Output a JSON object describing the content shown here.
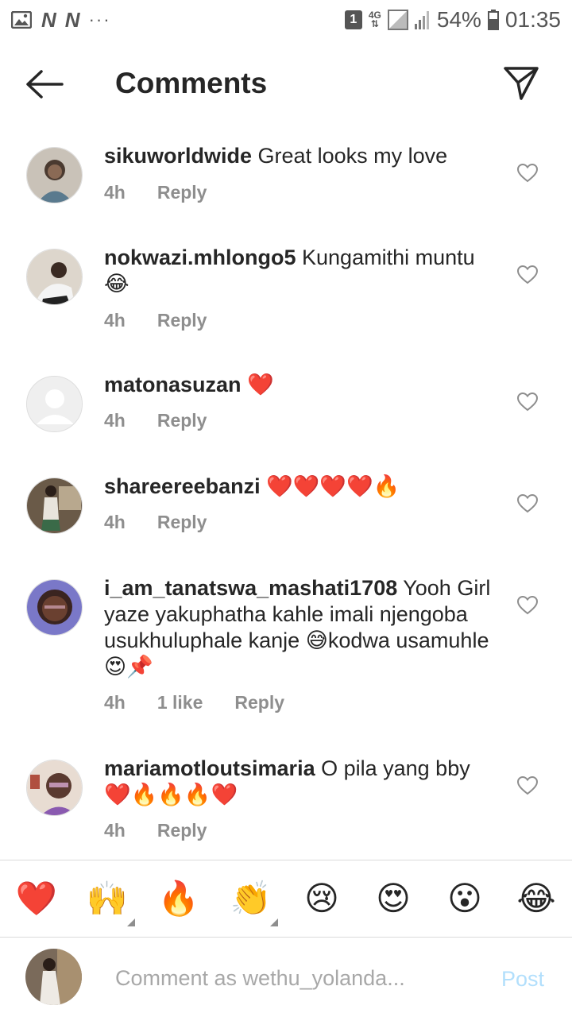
{
  "status_bar": {
    "sim_slot": "1",
    "network": "4G",
    "battery": "54%",
    "time": "01:35",
    "dots": "···"
  },
  "header": {
    "title": "Comments",
    "back_icon": "arrow-left-icon",
    "send_icon": "paper-plane-icon"
  },
  "comments": [
    {
      "username": "sikuworldwide",
      "text": " Great looks my love",
      "time": "4h",
      "likes": "",
      "reply": "Reply"
    },
    {
      "username": "nokwazi.mhlongo5",
      "text": " Kungamithi muntu 😂",
      "time": "4h",
      "likes": "",
      "reply": "Reply"
    },
    {
      "username": "matonasuzan",
      "text": " ❤️",
      "time": "4h",
      "likes": "",
      "reply": "Reply"
    },
    {
      "username": "shareereebanzi",
      "text": " ❤️❤️❤️❤️🔥",
      "time": "4h",
      "likes": "",
      "reply": "Reply"
    },
    {
      "username": "i_am_tanatswa_mashati1708",
      "text": " Yooh Girl yaze yakuphatha kahle imali njengoba usukhuluphale kanje 😅kodwa usamuhle 😍📌",
      "time": "4h",
      "likes": "1 like",
      "reply": "Reply"
    },
    {
      "username": "mariamotloutsimaria",
      "text": " O pila yang bby ❤️🔥🔥🔥❤️",
      "time": "4h",
      "likes": "",
      "reply": "Reply"
    }
  ],
  "emoji_bar": [
    "❤️",
    "🙌",
    "🔥",
    "👏",
    "😢",
    "😍",
    "😮",
    "😂"
  ],
  "input": {
    "placeholder": "Comment as wethu_yolanda...",
    "post_label": "Post"
  },
  "colors": {
    "meta_gray": "#8e8e8e",
    "post_disabled": "#b2dffc",
    "text": "#262626"
  }
}
